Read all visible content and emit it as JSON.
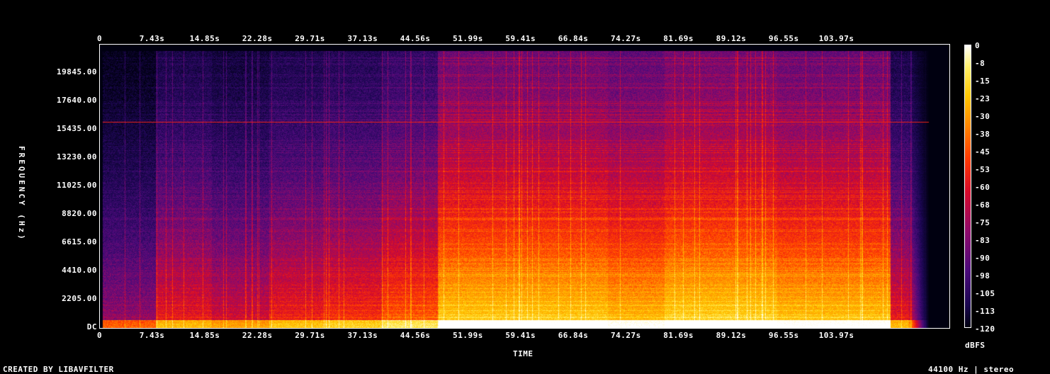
{
  "chart_data": {
    "type": "heatmap",
    "subtype": "spectrogram",
    "xlabel": "TIME",
    "ylabel": "FREQUENCY (Hz)",
    "x_ticks": [
      "0",
      "7.43s",
      "14.85s",
      "22.28s",
      "29.71s",
      "37.13s",
      "44.56s",
      "51.99s",
      "59.41s",
      "66.84s",
      "74.27s",
      "81.69s",
      "89.12s",
      "96.55s",
      "103.97s"
    ],
    "x_range_s": [
      0,
      111.4
    ],
    "y_ticks": [
      "DC",
      "2205.00",
      "4410.00",
      "6615.00",
      "8820.00",
      "11025.00",
      "13230.00",
      "15435.00",
      "17640.00",
      "19845.00"
    ],
    "y_range_hz": [
      0,
      22050
    ],
    "colorbar": {
      "label": "dBFS",
      "ticks": [
        "0",
        "-8",
        "-15",
        "-23",
        "-30",
        "-38",
        "-45",
        "-53",
        "-60",
        "-68",
        "-75",
        "-83",
        "-90",
        "-98",
        "-105",
        "-113",
        "-120"
      ],
      "range_db": [
        -120,
        0
      ],
      "colormap": [
        "#000010",
        "#1a0650",
        "#4a0a7a",
        "#8e0a6a",
        "#d60a2a",
        "#ff3a00",
        "#ff8a00",
        "#ffc600",
        "#ffee66",
        "#ffffff"
      ]
    },
    "segments": [
      {
        "t0": 0,
        "t1": 7.4,
        "level": 0.35
      },
      {
        "t0": 7.4,
        "t1": 14.8,
        "level": 0.5
      },
      {
        "t0": 14.8,
        "t1": 22.3,
        "level": 0.45
      },
      {
        "t0": 22.3,
        "t1": 29.7,
        "level": 0.52
      },
      {
        "t0": 29.7,
        "t1": 37.1,
        "level": 0.55
      },
      {
        "t0": 37.1,
        "t1": 44.6,
        "level": 0.62
      },
      {
        "t0": 44.6,
        "t1": 66.8,
        "level": 0.82
      },
      {
        "t0": 66.8,
        "t1": 74.3,
        "level": 0.78
      },
      {
        "t0": 74.3,
        "t1": 89.1,
        "level": 0.84
      },
      {
        "t0": 89.1,
        "t1": 104,
        "level": 0.8
      },
      {
        "t0": 104,
        "t1": 111.4,
        "level": 0.5
      }
    ],
    "tone_line_hz": 16000
  },
  "footer": {
    "left": "CREATED BY LIBAVFILTER",
    "right": "44100 Hz | stereo"
  }
}
